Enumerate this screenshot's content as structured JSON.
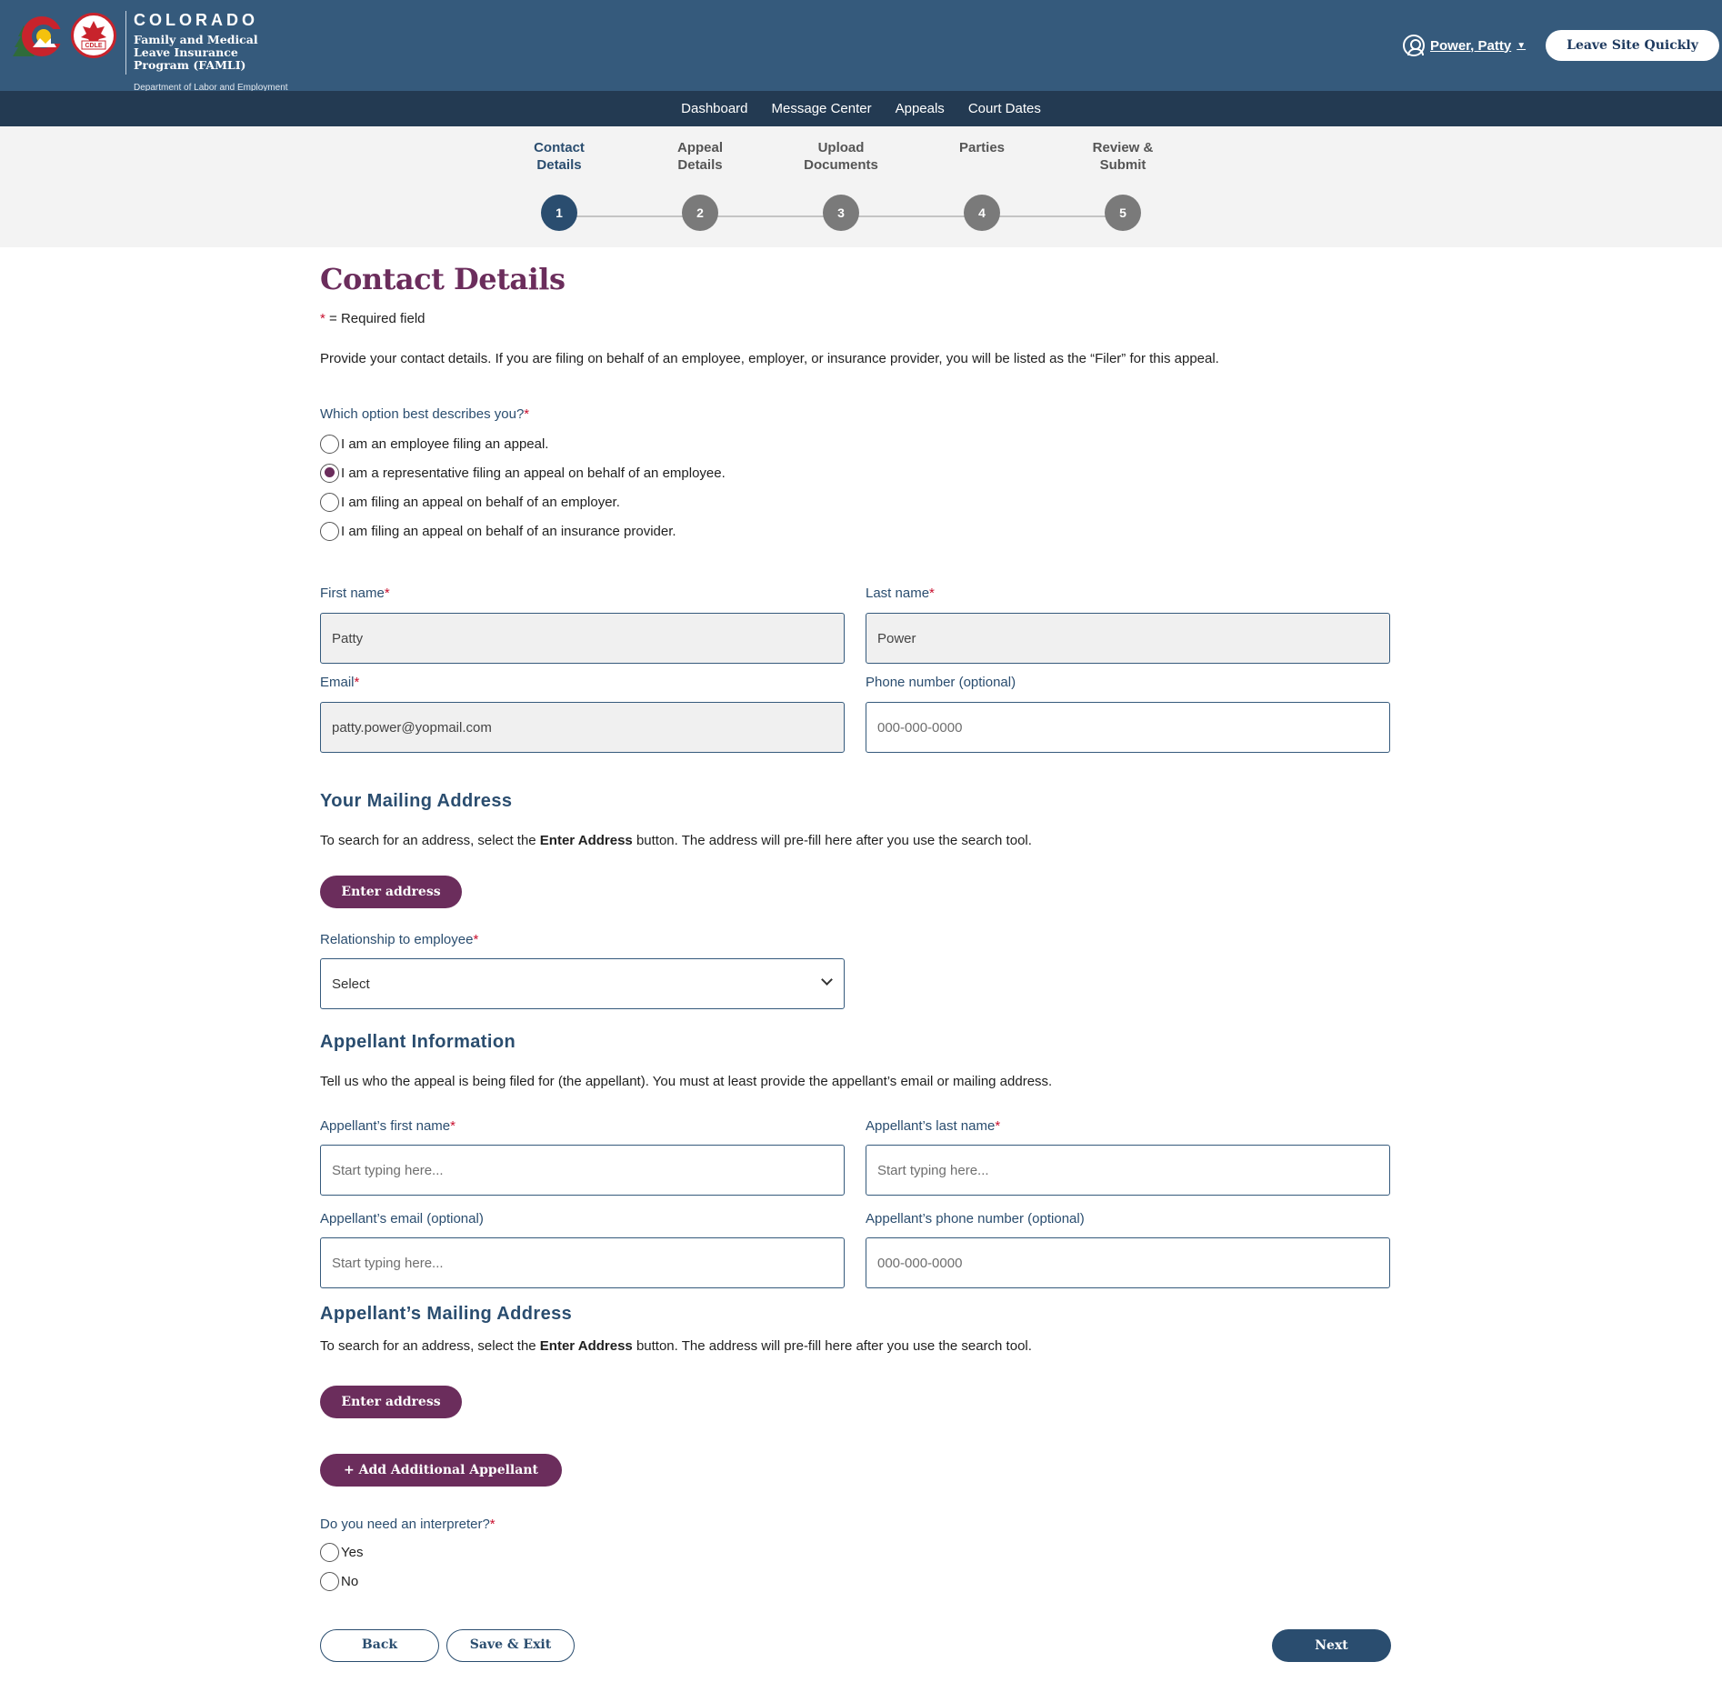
{
  "header": {
    "brand_state": "COLORADO",
    "brand_program": "Family and Medical Leave Insurance Program (FAMLI)",
    "brand_dept": "Department of Labor and Employment",
    "cdle_badge": "CDLE",
    "user_name": "Power, Patty",
    "leave_button": "Leave Site Quickly"
  },
  "nav": {
    "items": [
      "Dashboard",
      "Message Center",
      "Appeals",
      "Court Dates"
    ]
  },
  "stepper": {
    "steps": [
      {
        "label_line1": "Contact",
        "label_line2": "Details",
        "number": "1",
        "active": true
      },
      {
        "label_line1": "Appeal",
        "label_line2": "Details",
        "number": "2",
        "active": false
      },
      {
        "label_line1": "Upload",
        "label_line2": "Documents",
        "number": "3",
        "active": false
      },
      {
        "label_line1": "Parties",
        "label_line2": "",
        "number": "4",
        "active": false
      },
      {
        "label_line1": "Review &",
        "label_line2": "Submit",
        "number": "5",
        "active": false
      }
    ]
  },
  "page": {
    "title": "Contact Details",
    "required_star": "*",
    "required_note": "= Required field",
    "intro": "Provide your contact details. If you are filing on behalf of an employee, employer, or insurance provider, you will be listed as the “Filer” for this appeal."
  },
  "role_question": {
    "label": "Which option best describes you?",
    "options": [
      {
        "text": "I am an employee filing an appeal.",
        "checked": false
      },
      {
        "text": "I am a representative filing an appeal on behalf of an employee.",
        "checked": true
      },
      {
        "text": "I am filing an appeal on behalf of an employer.",
        "checked": false
      },
      {
        "text": "I am filing an appeal on behalf of an insurance provider.",
        "checked": false
      }
    ]
  },
  "contact": {
    "first_name_label": "First name",
    "first_name_value": "Patty",
    "last_name_label": "Last name",
    "last_name_value": "Power",
    "email_label": "Email",
    "email_value": "patty.power@yopmail.com",
    "phone_label": "Phone number (optional)",
    "phone_placeholder": "000-000-0000"
  },
  "mailing": {
    "title": "Your Mailing Address",
    "helper_pre": "To search for an address, select the ",
    "helper_bold": "Enter Address",
    "helper_post": " button. The address will pre-fill here after you use the search tool.",
    "button": "Enter address"
  },
  "relationship": {
    "label": "Relationship to employee",
    "value": "Select"
  },
  "appellant": {
    "title": "Appellant Information",
    "helper": "Tell us who the appeal is being filed for (the appellant). You must at least provide the appellant’s email or mailing address.",
    "first_name_label": "Appellant’s first name",
    "last_name_label": "Appellant’s last name",
    "email_label": "Appellant’s email (optional)",
    "phone_label": "Appellant’s phone number (optional)",
    "text_placeholder": "Start typing here...",
    "phone_placeholder": "000-000-0000"
  },
  "appellant_mailing": {
    "title": "Appellant’s Mailing Address",
    "helper_pre": "To search for an address, select the ",
    "helper_bold": "Enter Address",
    "helper_post": " button. The address will pre-fill here after you use the search tool.",
    "button": "Enter address",
    "add_button": "+ Add Additional Appellant"
  },
  "interpreter": {
    "label": "Do you need an interpreter?",
    "options": [
      "Yes",
      "No"
    ]
  },
  "footer": {
    "back": "Back",
    "save_exit": "Save & Exit",
    "next": "Next"
  },
  "colors": {
    "header_blue": "#355a7c",
    "nav_navy": "#233a52",
    "title_plum": "#6b2d5c",
    "label_blue": "#2a4d6f",
    "required_red": "#c8102e"
  }
}
